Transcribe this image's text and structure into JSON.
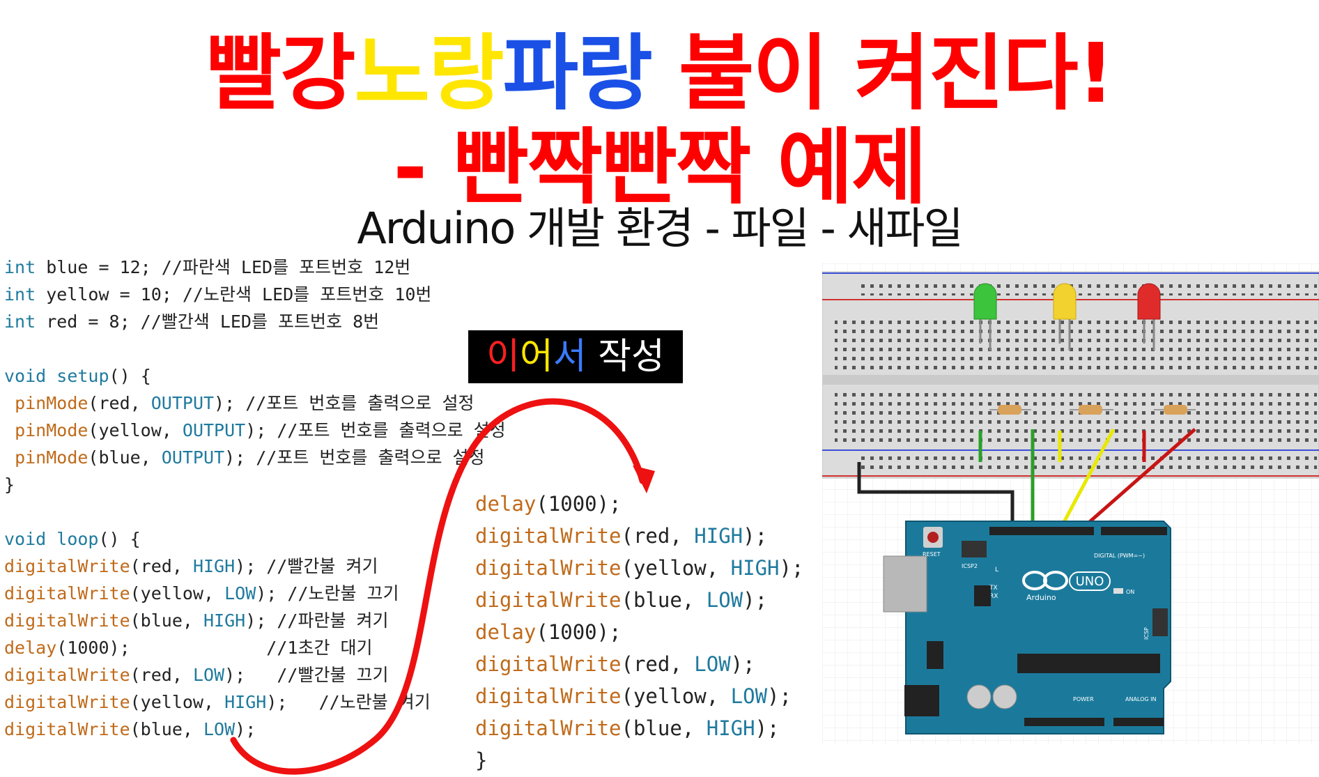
{
  "title": {
    "line1_parts": [
      {
        "text": "빨강",
        "color": "#ff0000"
      },
      {
        "text": "노랑",
        "color": "#ffe600"
      },
      {
        "text": "파랑",
        "color": "#1a50e6"
      },
      {
        "text": " 불이 켜진다!",
        "color": "#ff0000"
      }
    ],
    "line2": "- 빤짝빤짝 예제",
    "line2_color": "#ff0000",
    "subtitle": "Arduino 개발 환경 - 파일 - 새파일"
  },
  "badge": {
    "parts": [
      {
        "text": "이",
        "color": "#ff2020"
      },
      {
        "text": "어",
        "color": "#ffe600"
      },
      {
        "text": "서",
        "color": "#3a7bff"
      },
      {
        "text": " 작성",
        "color": "#ffffff"
      }
    ]
  },
  "code_left": [
    [
      {
        "t": "int",
        "c": "kw"
      },
      {
        "t": " blue = 12; //파란색 LED를 포트번호 12번"
      }
    ],
    [
      {
        "t": "int",
        "c": "kw"
      },
      {
        "t": " yellow = 10; //노란색 LED를 포트번호 10번"
      }
    ],
    [
      {
        "t": "int",
        "c": "kw"
      },
      {
        "t": " red = 8; //빨간색 LED를 포트번호 8번"
      }
    ],
    [],
    [
      {
        "t": "void",
        "c": "kw"
      },
      {
        "t": " "
      },
      {
        "t": "setup",
        "c": "kw"
      },
      {
        "t": "() {"
      }
    ],
    [
      {
        "t": " "
      },
      {
        "t": "pinMode",
        "c": "fn"
      },
      {
        "t": "(red, "
      },
      {
        "t": "OUTPUT",
        "c": "cst"
      },
      {
        "t": "); //포트 번호를 출력으로 설정"
      }
    ],
    [
      {
        "t": " "
      },
      {
        "t": "pinMode",
        "c": "fn"
      },
      {
        "t": "(yellow, "
      },
      {
        "t": "OUTPUT",
        "c": "cst"
      },
      {
        "t": "); //포트 번호를 출력으로 설정"
      }
    ],
    [
      {
        "t": " "
      },
      {
        "t": "pinMode",
        "c": "fn"
      },
      {
        "t": "(blue, "
      },
      {
        "t": "OUTPUT",
        "c": "cst"
      },
      {
        "t": "); //포트 번호를 출력으로 설정"
      }
    ],
    [
      {
        "t": "}"
      }
    ],
    [],
    [
      {
        "t": "void",
        "c": "kw"
      },
      {
        "t": " "
      },
      {
        "t": "loop",
        "c": "kw"
      },
      {
        "t": "() {"
      }
    ],
    [
      {
        "t": "digitalWrite",
        "c": "fn"
      },
      {
        "t": "(red, "
      },
      {
        "t": "HIGH",
        "c": "cst"
      },
      {
        "t": "); //빨간불 켜기"
      }
    ],
    [
      {
        "t": "digitalWrite",
        "c": "fn"
      },
      {
        "t": "(yellow, "
      },
      {
        "t": "LOW",
        "c": "cst"
      },
      {
        "t": "); //노란불 끄기"
      }
    ],
    [
      {
        "t": "digitalWrite",
        "c": "fn"
      },
      {
        "t": "(blue, "
      },
      {
        "t": "HIGH",
        "c": "cst"
      },
      {
        "t": "); //파란불 켜기"
      }
    ],
    [
      {
        "t": "delay",
        "c": "fn"
      },
      {
        "t": "(1000);             //1초간 대기"
      }
    ],
    [
      {
        "t": "digitalWrite",
        "c": "fn"
      },
      {
        "t": "(red, "
      },
      {
        "t": "LOW",
        "c": "cst"
      },
      {
        "t": ");   //빨간불 끄기"
      }
    ],
    [
      {
        "t": "digitalWrite",
        "c": "fn"
      },
      {
        "t": "(yellow, "
      },
      {
        "t": "HIGH",
        "c": "cst"
      },
      {
        "t": ");   //노란불 켜기"
      }
    ],
    [
      {
        "t": "digitalWrite",
        "c": "fn"
      },
      {
        "t": "(blue, "
      },
      {
        "t": "LOW",
        "c": "cst"
      },
      {
        "t": ");"
      }
    ]
  ],
  "code_right": [
    [
      {
        "t": "delay",
        "c": "fn"
      },
      {
        "t": "(1000);"
      }
    ],
    [
      {
        "t": "digitalWrite",
        "c": "fn"
      },
      {
        "t": "(red, "
      },
      {
        "t": "HIGH",
        "c": "cst"
      },
      {
        "t": ");"
      }
    ],
    [
      {
        "t": "digitalWrite",
        "c": "fn"
      },
      {
        "t": "(yellow, "
      },
      {
        "t": "HIGH",
        "c": "cst"
      },
      {
        "t": ");"
      }
    ],
    [
      {
        "t": "digitalWrite",
        "c": "fn"
      },
      {
        "t": "(blue, "
      },
      {
        "t": "LOW",
        "c": "cst"
      },
      {
        "t": ");"
      }
    ],
    [
      {
        "t": "delay",
        "c": "fn"
      },
      {
        "t": "(1000);"
      }
    ],
    [
      {
        "t": "digitalWrite",
        "c": "fn"
      },
      {
        "t": "(red, "
      },
      {
        "t": "LOW",
        "c": "cst"
      },
      {
        "t": ");"
      }
    ],
    [
      {
        "t": "digitalWrite",
        "c": "fn"
      },
      {
        "t": "(yellow, "
      },
      {
        "t": "LOW",
        "c": "cst"
      },
      {
        "t": ");"
      }
    ],
    [
      {
        "t": "digitalWrite",
        "c": "fn"
      },
      {
        "t": "(blue, "
      },
      {
        "t": "HIGH",
        "c": "cst"
      },
      {
        "t": ");"
      }
    ],
    [
      {
        "t": "}"
      }
    ]
  ],
  "circuit": {
    "board_labels": {
      "reset": "RESET",
      "icsp2": "ICSP2",
      "logo_text": "UNO",
      "brand": "Arduino",
      "on": "ON",
      "tx": "TX",
      "rx": "RX",
      "l": "L",
      "digital": "DIGITAL (PWM=~)",
      "icsp": "ICSP",
      "power": "POWER",
      "analog": "ANALOG IN"
    },
    "led_colors": [
      "#3cc43c",
      "#f2d22e",
      "#e02b2b"
    ],
    "wire_colors": {
      "gnd": "#222222",
      "blue_pin": "#2aa02a",
      "yellow_pin": "#e8e800",
      "red_pin": "#c81414"
    }
  }
}
